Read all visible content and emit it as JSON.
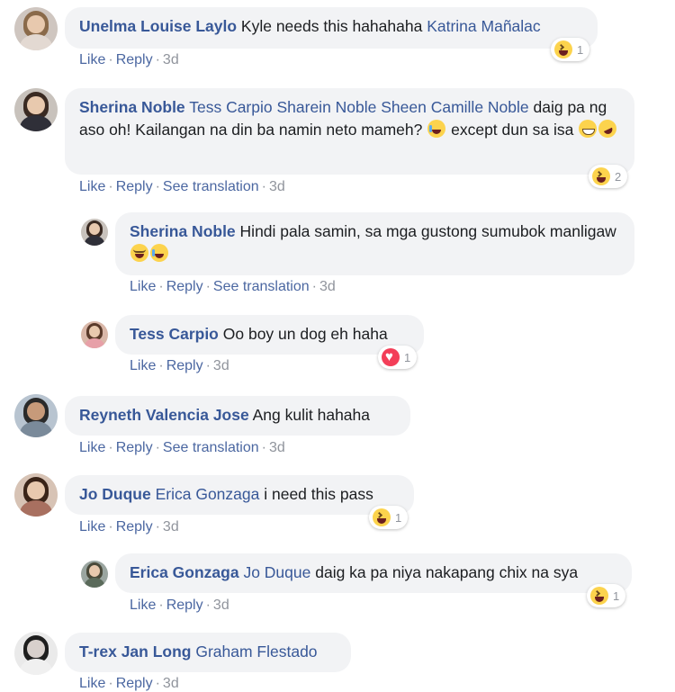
{
  "comments": [
    {
      "author": "Unelma Louise Laylo",
      "text": "Kyle needs this hahahaha ",
      "tag": "Katrina Mañalac",
      "actions": {
        "like": "Like",
        "reply": "Reply",
        "time": "3d"
      },
      "reaction": {
        "type": "haha",
        "count": "1"
      }
    },
    {
      "author": "Sherina Noble",
      "tags": "Tess Carpio Sharein Noble Sheen Camille Noble",
      "text1": " daig pa ng aso oh! Kailangan na din ba namin neto mameh? ",
      "text2": " except dun sa isa ",
      "actions": {
        "like": "Like",
        "reply": "Reply",
        "translate": "See translation",
        "time": "3d"
      },
      "reaction": {
        "type": "haha",
        "count": "2"
      }
    },
    {
      "author": "Sherina Noble",
      "text": "Hindi pala samin, sa mga gustong sumubok manligaw ",
      "actions": {
        "like": "Like",
        "reply": "Reply",
        "translate": "See translation",
        "time": "3d"
      }
    },
    {
      "author": "Tess Carpio",
      "text": "Oo boy un dog eh haha",
      "actions": {
        "like": "Like",
        "reply": "Reply",
        "time": "3d"
      },
      "reaction": {
        "type": "love",
        "count": "1"
      }
    },
    {
      "author": "Reyneth Valencia Jose",
      "text": "Ang kulit hahaha",
      "actions": {
        "like": "Like",
        "reply": "Reply",
        "translate": "See translation",
        "time": "3d"
      }
    },
    {
      "author": "Jo Duque",
      "tag": "Erica Gonzaga",
      "text": " i need this pass",
      "actions": {
        "like": "Like",
        "reply": "Reply",
        "time": "3d"
      },
      "reaction": {
        "type": "haha",
        "count": "1"
      }
    },
    {
      "author": "Erica Gonzaga",
      "tag": "Jo Duque",
      "text": " daig ka pa niya nakapang chix na sya",
      "actions": {
        "like": "Like",
        "reply": "Reply",
        "time": "3d"
      },
      "reaction": {
        "type": "zany",
        "count": "1"
      }
    },
    {
      "author": "T-rex Jan Long",
      "tag": "Graham Flestado",
      "actions": {
        "like": "Like",
        "reply": "Reply",
        "time": "3d"
      }
    }
  ],
  "separator": "·",
  "colors": {
    "link": "#385898",
    "bubble": "#f2f3f5",
    "meta": "#90949c"
  }
}
